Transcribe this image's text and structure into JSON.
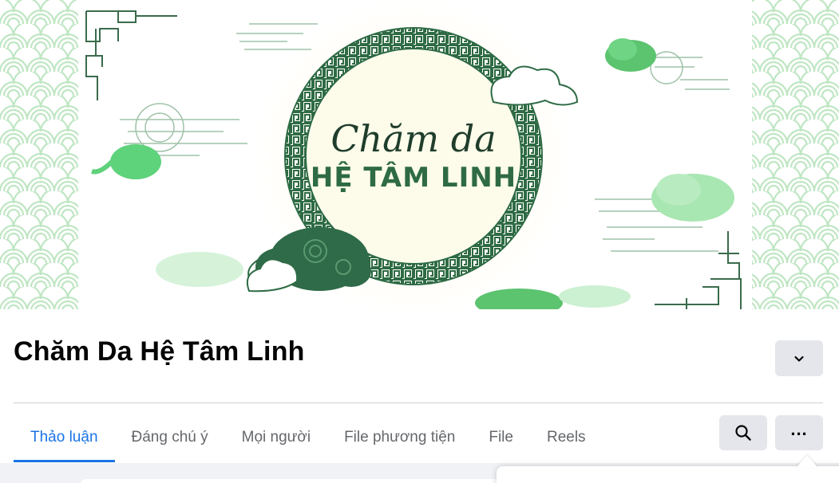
{
  "cover": {
    "script_text": "Chăm da",
    "banner_text": "HỆ TÂM LINH",
    "colors": {
      "dark_green": "#2e6b45",
      "mid_green": "#5fc878",
      "light_green": "#b8ebc0",
      "cream": "#fdfbe9"
    }
  },
  "group": {
    "title": "Chăm Da Hệ Tâm Linh"
  },
  "tabs": [
    {
      "label": "Thảo luận",
      "active": true
    },
    {
      "label": "Đáng chú ý",
      "active": false
    },
    {
      "label": "Mọi người",
      "active": false
    },
    {
      "label": "File phương tiện",
      "active": false
    },
    {
      "label": "File",
      "active": false
    },
    {
      "label": "Reels",
      "active": false
    }
  ],
  "actions": {
    "search_icon": "search-icon",
    "more_label": "...",
    "collapse_icon": "chevron-down-icon"
  },
  "colors": {
    "accent": "#1b74e4",
    "button_bg": "#e4e6eb",
    "text_secondary": "#65676b"
  }
}
